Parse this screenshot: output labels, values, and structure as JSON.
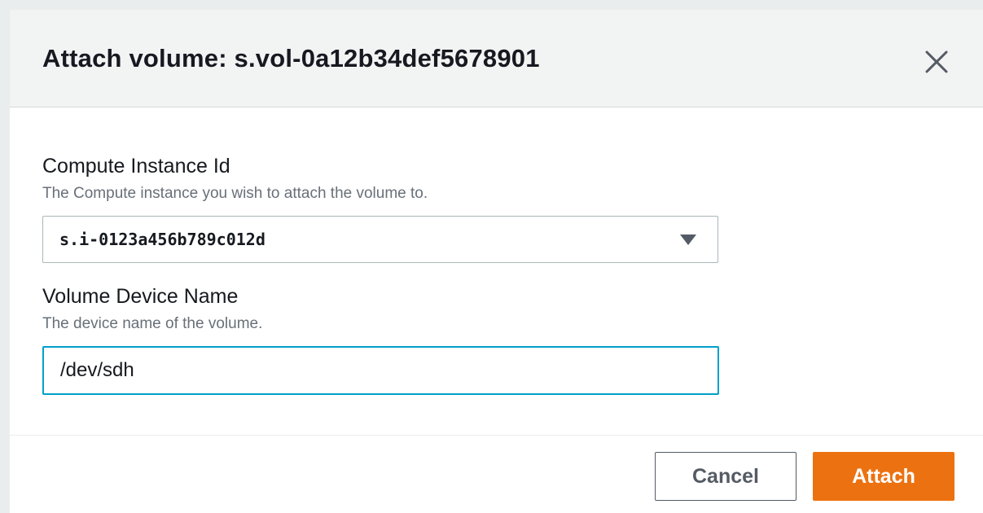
{
  "modal": {
    "title_prefix": "Attach volume: ",
    "volume_id": "s.vol-0a12b34def5678901"
  },
  "instance_field": {
    "label": "Compute Instance Id",
    "description": "The Compute instance you wish to attach the volume to.",
    "selected_value": "s.i-0123a456b789c012d"
  },
  "device_field": {
    "label": "Volume Device Name",
    "description": "The device name of the volume.",
    "value": "/dev/sdh"
  },
  "footer": {
    "cancel_label": "Cancel",
    "attach_label": "Attach"
  },
  "colors": {
    "primary_button": "#ec7211",
    "focus_border": "#00a1c9",
    "header_background": "#f2f3f3"
  },
  "icons": {
    "close": "close-icon",
    "dropdown": "caret-down-icon"
  }
}
